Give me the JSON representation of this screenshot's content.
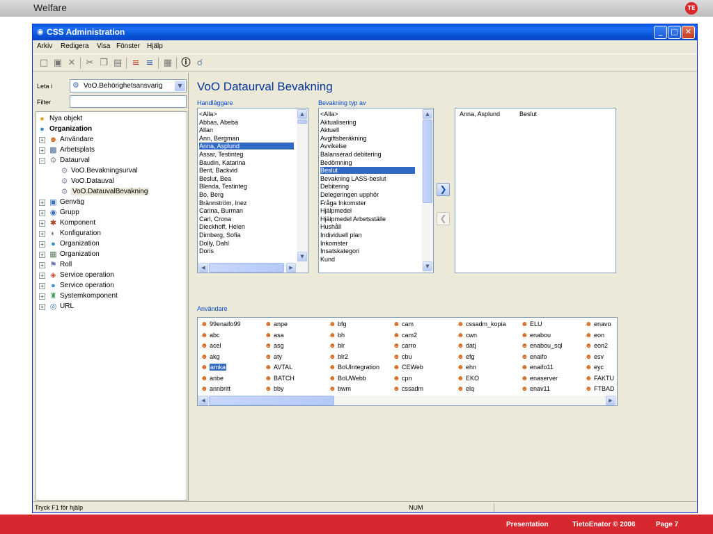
{
  "slide": {
    "title": "Welfare",
    "logo_text": "TE",
    "footer": {
      "presentation": "Presentation",
      "copyright": "TietoEnator © 2006",
      "page": "Page 7"
    }
  },
  "window": {
    "title": "CSS Administration",
    "menu": [
      "Arkiv",
      "Redigera",
      "Visa",
      "Fönster",
      "Hjälp"
    ],
    "status_help": "Tryck F1 för hjälp",
    "status_num": "NUM"
  },
  "left": {
    "leta_label": "Leta i",
    "leta_value": "VoO.Behörighetsansvarig",
    "filter_label": "Filter",
    "filter_value": "",
    "tree": [
      {
        "label": "Nya objekt",
        "icon": "globe-icon",
        "bold": false
      },
      {
        "label": "Organization",
        "icon": "globe-icon",
        "bold": true
      },
      {
        "label": "Användare",
        "icon": "user-icon",
        "bold": false
      },
      {
        "label": "Arbetsplats",
        "icon": "workplace-icon",
        "bold": false
      },
      {
        "label": "Dataurval",
        "icon": "gear-icon",
        "bold": false
      },
      {
        "label": "VoO.Bevakningsurval",
        "icon": "gear-icon",
        "bold": false
      },
      {
        "label": "VoO.Datauval",
        "icon": "gear-icon",
        "bold": false
      },
      {
        "label": "VoO.DatauvalBevakning",
        "icon": "gear-icon",
        "bold": false
      },
      {
        "label": "Genväg",
        "icon": "shortcut-icon",
        "bold": false
      },
      {
        "label": "Grupp",
        "icon": "group-icon",
        "bold": false
      },
      {
        "label": "Komponent",
        "icon": "component-icon",
        "bold": false
      },
      {
        "label": "Konfiguration",
        "icon": "config-icon",
        "bold": false
      },
      {
        "label": "Organization",
        "icon": "globe-icon",
        "bold": false
      },
      {
        "label": "Organization",
        "icon": "grid-icon",
        "bold": false
      },
      {
        "label": "Roll",
        "icon": "role-icon",
        "bold": false
      },
      {
        "label": "Service operation",
        "icon": "service-icon",
        "bold": false
      },
      {
        "label": "Service operation",
        "icon": "globe-icon",
        "bold": false
      },
      {
        "label": "Systemkomponent",
        "icon": "system-icon",
        "bold": false
      },
      {
        "label": "URL",
        "icon": "url-icon",
        "bold": false
      }
    ]
  },
  "right": {
    "heading": "VoO Dataurval Bevakning",
    "handlaggare_label": "Handläggare",
    "handlaggare": [
      "<Alla>",
      "Abbas, Abeba",
      "Allan",
      "Ann, Bergman",
      "Anna, Asplund",
      "Assar, Testinteg",
      "Baudin, Katarina",
      "Berit, Backvid",
      "Beslut, Bea",
      "Blenda, Testinteg",
      "Bo, Berg",
      "Brännström, Inez",
      "Carina, Burman",
      "Carl, Crona",
      "Dieckhoff, Helen",
      "Dimberg, Sofia",
      "Dolly, Dahl",
      "Doris"
    ],
    "handlaggare_selected": "Anna, Asplund",
    "bevakning_label": "Bevakning typ av",
    "bevakning": [
      "<Alla>",
      "Aktualisering",
      "Aktuell",
      "Avgiftsberäkning",
      "Avvikelse",
      "Balanserad debitering",
      "Bedömning",
      "Beslut",
      "Bevakning LASS-beslut",
      "Debitering",
      "Delegeringen upphör",
      "Fråga Inkomster",
      "Hjälpmedel",
      "Hjälpmedel Arbetsställe",
      "Hushåll",
      "Individuell plan",
      "Inkomster",
      "Insatskategori",
      "Kund"
    ],
    "bevakning_selected": "Beslut",
    "result": {
      "name": "Anna, Asplund",
      "type": "Beslut"
    },
    "anvandare_label": "Användare",
    "users_columns": [
      [
        "99enaifo99",
        "abc",
        "acel",
        "akg",
        "amka",
        "anbe",
        "annbritt"
      ],
      [
        "anpe",
        "asa",
        "asg",
        "aty",
        "AVTAL",
        "BATCH",
        "bby"
      ],
      [
        "bfg",
        "bh",
        "blr",
        "blr2",
        "BoUIntegration",
        "BoUWebb",
        "bwm"
      ],
      [
        "cam",
        "cam2",
        "carro",
        "cbu",
        "CEWeb",
        "cpn",
        "cssadm"
      ],
      [
        "cssadm_kopia",
        "cwn",
        "datj",
        "efg",
        "ehn",
        "EKO",
        "elq"
      ],
      [
        "ELU",
        "enabou",
        "enabou_sql",
        "enaifo",
        "enaifo11",
        "enaserver",
        "enav11"
      ],
      [
        "enavo",
        "eon",
        "eon2",
        "esv",
        "eyc",
        "FAKTU",
        "FTBAD"
      ]
    ],
    "users_selected": "amka"
  },
  "colors": {
    "accent": "#316ac5",
    "heading": "#003399",
    "footer": "#d6282e"
  }
}
